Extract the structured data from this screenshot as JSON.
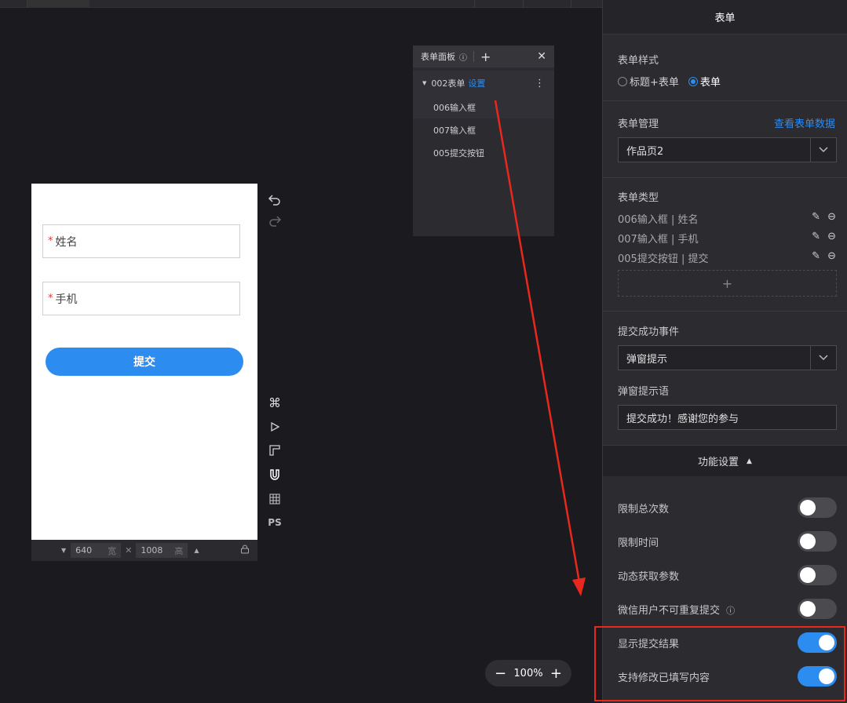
{
  "canvas": {
    "fields": [
      {
        "required_mark": "*",
        "label": "姓名"
      },
      {
        "required_mark": "*",
        "label": "手机"
      }
    ],
    "submit_label": "提交"
  },
  "sizebar": {
    "width_value": "640",
    "width_unit": "宽",
    "times": "✕",
    "height_value": "1008",
    "height_unit": "高"
  },
  "tools": {
    "ps_label": "PS"
  },
  "form_panel": {
    "title": "表单面板",
    "root_item": "002表单",
    "root_link": "设置",
    "children": [
      "006输入框",
      "007输入框",
      "005提交按钮"
    ]
  },
  "props": {
    "title": "表单",
    "style_section": {
      "label": "表单样式",
      "options": [
        "标题+表单",
        "表单"
      ],
      "selected": "表单"
    },
    "manage_section": {
      "label": "表单管理",
      "link": "查看表单数据",
      "value": "作品页2"
    },
    "type_section": {
      "label": "表单类型",
      "items": [
        "006输入框 | 姓名",
        "007输入框 | 手机",
        "005提交按钮 | 提交"
      ],
      "add_symbol": "+"
    },
    "event_section": {
      "label": "提交成功事件",
      "value": "弹窗提示",
      "prompt_label": "弹窗提示语",
      "prompt_value": "提交成功！感谢您的参与"
    },
    "features": {
      "header": "功能设置",
      "items": [
        {
          "label": "限制总次数",
          "on": false
        },
        {
          "label": "限制时间",
          "on": false
        },
        {
          "label": "动态获取参数",
          "on": false
        },
        {
          "label": "微信用户不可重复提交",
          "on": false
        },
        {
          "label": "显示提交结果",
          "on": true
        },
        {
          "label": "支持修改已填写内容",
          "on": true
        }
      ]
    }
  },
  "zoom": {
    "minus": "−",
    "value": "100%",
    "plus": "+"
  },
  "colors": {
    "accent": "#2d8cf0",
    "annotation_red": "#e8281e",
    "background": "#1b1b1f",
    "panel": "#2b2b30"
  }
}
